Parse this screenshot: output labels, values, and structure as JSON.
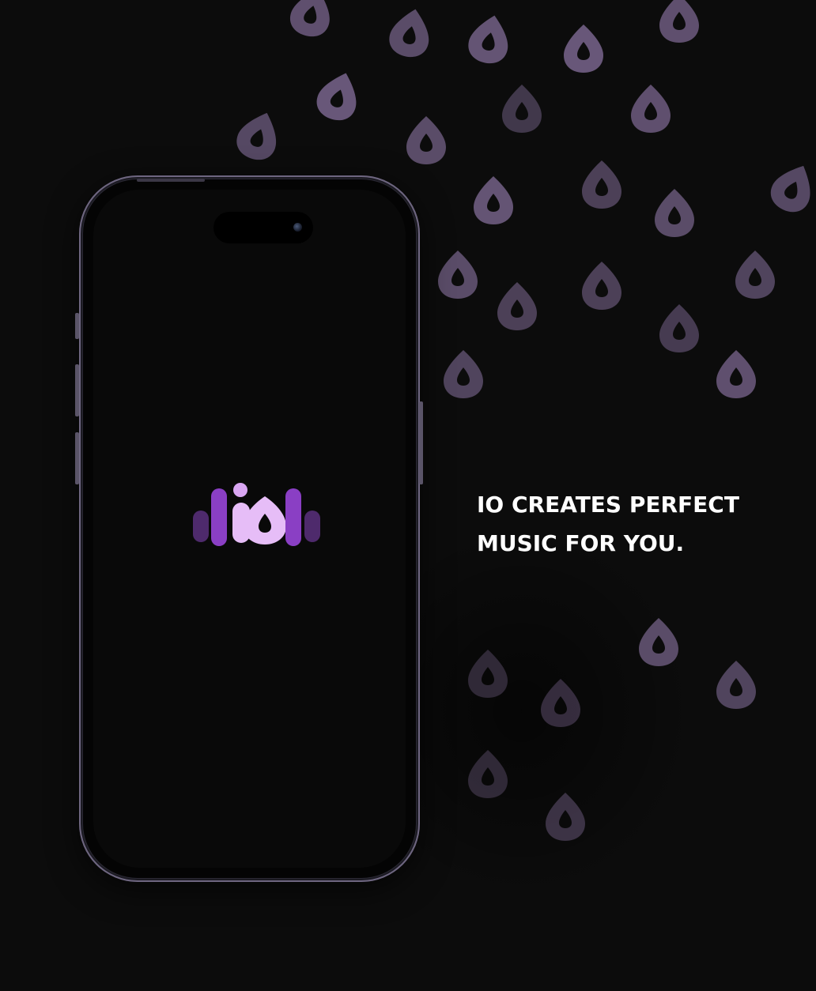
{
  "tagline": {
    "line1": "IO CREATES PERFECT",
    "line2": "MUSIC FOR YOU."
  },
  "logo": {
    "name": "io-logo",
    "colors": {
      "bar_dark": "#4e2a6c",
      "bar_mid": "#8a3fc4",
      "letters": "#e6bdf7",
      "dot": "#d9a6f2"
    }
  },
  "theme": {
    "background": "#0c0c0c",
    "drop_color": "#6e5c80",
    "text": "#ffffff"
  },
  "icons": [
    "drop-icon",
    "camera-icon",
    "io-logo"
  ]
}
